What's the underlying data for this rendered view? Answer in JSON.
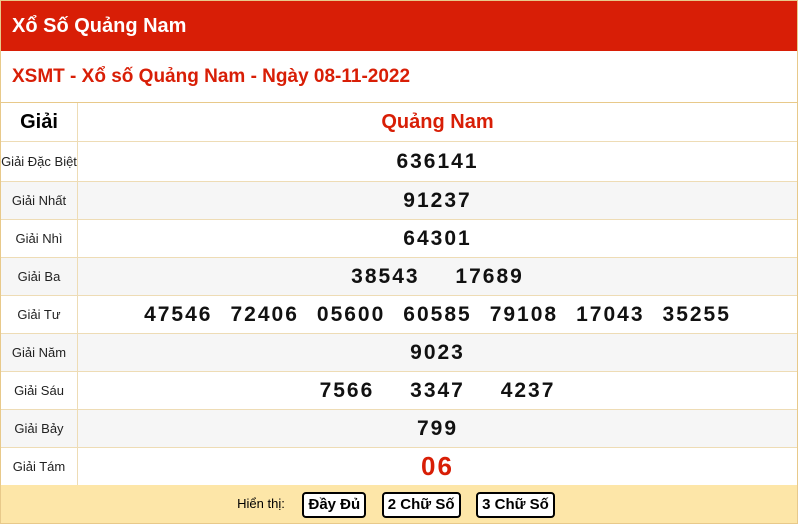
{
  "header": {
    "title": "Xổ Số Quảng Nam"
  },
  "subtitle": "XSMT - Xổ số Quảng Nam - Ngày 08-11-2022",
  "table": {
    "col_label": "Giải",
    "col_province": "Quảng Nam",
    "rows": [
      {
        "label": "Giải Đặc Biệt",
        "numbers": [
          "636141"
        ]
      },
      {
        "label": "Giải Nhất",
        "numbers": [
          "91237"
        ]
      },
      {
        "label": "Giải Nhì",
        "numbers": [
          "64301"
        ]
      },
      {
        "label": "Giải Ba",
        "numbers": [
          "38543",
          "17689"
        ]
      },
      {
        "label": "Giải Tư",
        "numbers": [
          "47546",
          "72406",
          "05600",
          "60585",
          "79108",
          "17043",
          "35255"
        ]
      },
      {
        "label": "Giải Năm",
        "numbers": [
          "9023"
        ]
      },
      {
        "label": "Giải Sáu",
        "numbers": [
          "7566",
          "3347",
          "4237"
        ]
      },
      {
        "label": "Giải Bảy",
        "numbers": [
          "799"
        ]
      },
      {
        "label": "Giải Tám",
        "numbers": [
          "06"
        ]
      }
    ]
  },
  "footer": {
    "label": "Hiển thị:",
    "buttons": [
      "Đầy Đủ",
      "2 Chữ Số",
      "3 Chữ Số"
    ]
  },
  "colors": {
    "accent": "#d81e06",
    "footer_bg": "#fde6a8",
    "border": "#e8c98a"
  }
}
